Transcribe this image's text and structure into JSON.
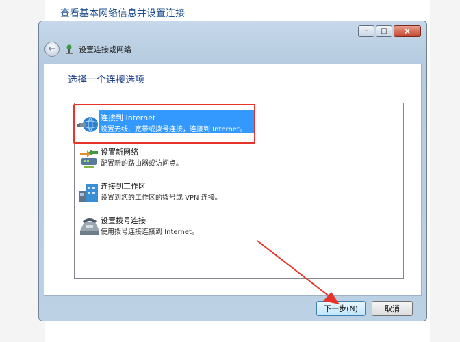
{
  "outer_caption": "查看基本网络信息并设置连接",
  "window": {
    "title": "设置连接或网络",
    "controls": {
      "minimize": "–",
      "maximize": "□",
      "close": "✕"
    },
    "heading": "选择一个连接选项",
    "options": [
      {
        "title": "连接到 Internet",
        "description": "设置无线、宽带或拨号连接，连接到 Internet。",
        "icon": "globe-network-icon",
        "selected": true
      },
      {
        "title": "设置新网络",
        "description": "配置新的路由器或访问点。",
        "icon": "router-network-icon",
        "selected": false
      },
      {
        "title": "连接到工作区",
        "description": "设置到您的工作区的拨号或 VPN 连接。",
        "icon": "workplace-building-icon",
        "selected": false
      },
      {
        "title": "设置拨号连接",
        "description": "使用拨号连接连接到 Internet。",
        "icon": "telephone-modem-icon",
        "selected": false
      }
    ],
    "buttons": {
      "next": "下一步(N)",
      "cancel": "取消"
    }
  },
  "colors": {
    "selection": "#3399ff",
    "highlight_box": "#e8332a",
    "arrow": "#e8332a",
    "heading": "#1e3f8a"
  }
}
